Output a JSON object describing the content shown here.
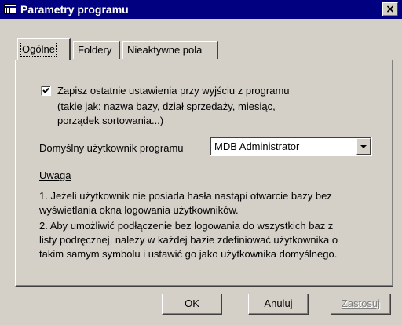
{
  "window": {
    "title": "Parametry programu",
    "close_glyph": "×"
  },
  "tabs": [
    {
      "label": "Ogólne",
      "active": true
    },
    {
      "label": "Foldery",
      "active": false
    },
    {
      "label": "Nieaktywne pola",
      "active": false
    }
  ],
  "general": {
    "save_settings": {
      "checked": true,
      "label": "Zapisz ostatnie ustawienia przy wyjściu z programu",
      "desc_line1": "(takie jak: nazwa bazy, dział sprzedaży, miesiąc,",
      "desc_line2": "porządek sortowania...)"
    },
    "default_user": {
      "label": "Domyślny użytkownik programu",
      "value": "MDB Administrator"
    },
    "note": {
      "title": "Uwaga",
      "line1": "1. Jeżeli użytkownik nie posiada hasła nastąpi otwarcie bazy bez",
      "line2": "wyświetlania okna logowania użytkowników.",
      "line3": "2. Aby umożliwić podłączenie bez logowania do wszystkich baz z",
      "line4": "listy podręcznej, należy w każdej bazie zdefiniować użytkownika o",
      "line5": "takim samym symbolu i ustawić go jako użytkownika domyślnego."
    }
  },
  "buttons": {
    "ok": "OK",
    "cancel": "Anuluj",
    "apply": "Zastosuj"
  },
  "colors": {
    "titlebar": "#000080",
    "face": "#d4d0c8",
    "disabled_text": "#808080"
  },
  "icons": {
    "window": "table-icon",
    "close": "close-icon",
    "check": "checkmark-icon",
    "dropdown": "chevron-down-icon"
  }
}
